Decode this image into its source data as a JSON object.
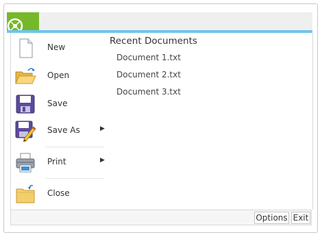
{
  "backstage": {
    "menu": [
      {
        "label": "New",
        "icon": "new-document-icon"
      },
      {
        "label": "Open",
        "icon": "open-folder-icon"
      },
      {
        "label": "Save",
        "icon": "save-disk-icon"
      },
      {
        "label": "Save As",
        "icon": "save-as-icon",
        "submenu": true
      },
      {
        "label": "Print",
        "icon": "printer-icon",
        "submenu": true
      },
      {
        "label": "Close",
        "icon": "close-folder-icon"
      }
    ],
    "recent": {
      "title": "Recent Documents",
      "items": [
        "Document 1.txt",
        "Document 2.txt",
        "Document 3.txt"
      ]
    }
  },
  "footer": {
    "options_label": "Options",
    "exit_label": "Exit"
  },
  "colors": {
    "accent": "#6ec5ee",
    "app_button": "#76b82a",
    "topbar": "#efefef"
  }
}
